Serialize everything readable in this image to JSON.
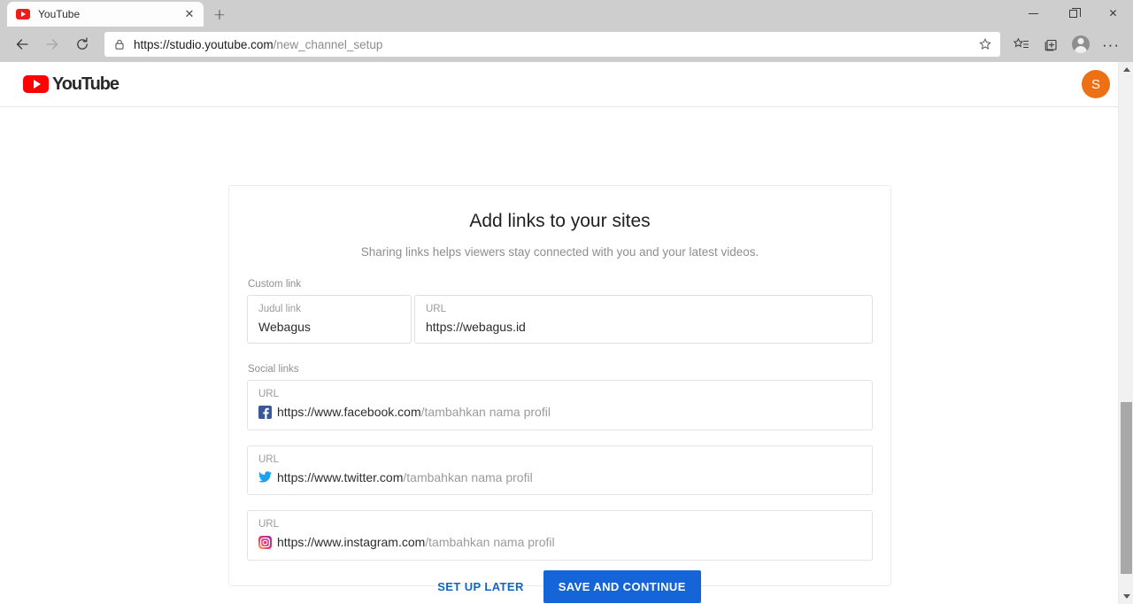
{
  "browser": {
    "tab": {
      "title": "YouTube",
      "favicon": "youtube-icon",
      "close_label": "✕"
    },
    "new_tab_label": "+",
    "window_controls": {
      "minimize": "minimize-icon",
      "restore": "restore-icon",
      "close": "✕"
    },
    "nav": {
      "back": "←",
      "forward": "→",
      "reload": "⟳"
    },
    "omnibox": {
      "lock": "lock-icon",
      "url_prefix": "https://studio.youtube.com",
      "url_suffix": "/new_channel_setup",
      "full_url": "https://studio.youtube.com/new_channel_setup",
      "favorite": "star-icon"
    },
    "toolbar_icons": {
      "collections": "favorites-list-icon",
      "tab_collections": "collections-icon",
      "profile": "profile-avatar-icon",
      "more": "···"
    }
  },
  "youtube_header": {
    "logo_text": "YouTube",
    "avatar_letter": "S",
    "avatar_color": "#ed7014"
  },
  "card": {
    "title": "Add links to your sites",
    "subtitle": "Sharing links helps viewers stay connected with you and your latest videos.",
    "custom_link": {
      "section_label": "Custom link",
      "title_field": {
        "label": "Judul link",
        "value": "Webagus"
      },
      "url_field": {
        "label": "URL",
        "value": "https://webagus.id"
      }
    },
    "social_links": {
      "section_label": "Social links",
      "items": [
        {
          "label": "URL",
          "icon": "facebook-icon",
          "prefix": "https://www.facebook.com",
          "placeholder": "/tambahkan nama profil"
        },
        {
          "label": "URL",
          "icon": "twitter-icon",
          "prefix": "https://www.twitter.com",
          "placeholder": "/tambahkan nama profil"
        },
        {
          "label": "URL",
          "icon": "instagram-icon",
          "prefix": "https://www.instagram.com",
          "placeholder": "/tambahkan nama profil"
        }
      ]
    }
  },
  "actions": {
    "secondary_label": "SET UP LATER",
    "primary_label": "SAVE AND CONTINUE",
    "primary_color": "#1565d8",
    "secondary_color": "#1565c0"
  }
}
